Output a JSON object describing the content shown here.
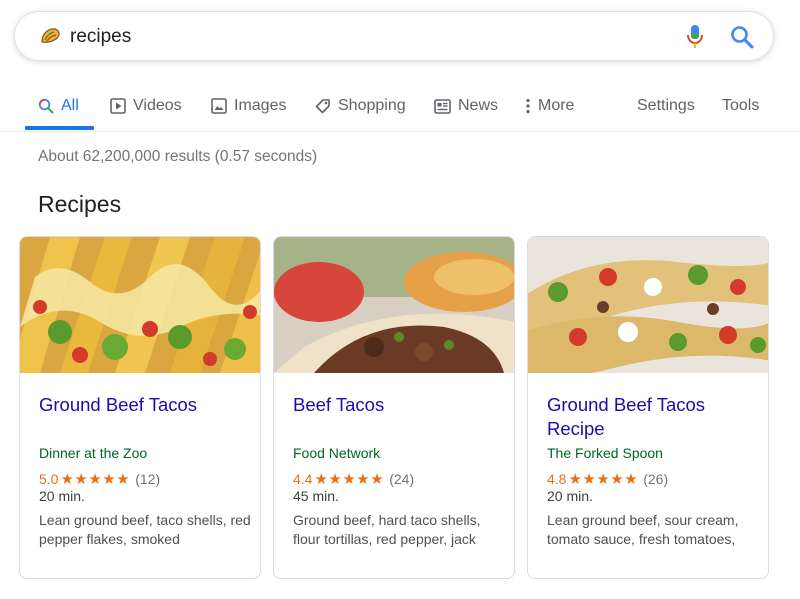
{
  "search": {
    "query": "recipes",
    "icons": {
      "left": "taco-doodle-icon",
      "mic": "mic-icon",
      "search": "search-icon"
    }
  },
  "tabs": [
    {
      "label": "All",
      "icon": "search-icon",
      "active": true
    },
    {
      "label": "Videos",
      "icon": "play-icon"
    },
    {
      "label": "Images",
      "icon": "image-icon"
    },
    {
      "label": "Shopping",
      "icon": "tag-icon"
    },
    {
      "label": "News",
      "icon": "newspaper-icon"
    },
    {
      "label": "More",
      "icon": "more-vertical-icon"
    }
  ],
  "tools": {
    "settings": "Settings",
    "tools": "Tools"
  },
  "results_stats": "About 62,200,000 results (0.57 seconds)",
  "section_title": "Recipes",
  "cards": [
    {
      "title": "Ground Beef Tacos",
      "source": "Dinner at the Zoo",
      "rating": "5.0",
      "stars": "★★★★★",
      "reviews": "(12)",
      "time": "20 min.",
      "ingredients": "Lean ground beef, taco shells, red pepper flakes, smoked"
    },
    {
      "title": "Beef Tacos",
      "source": "Food Network",
      "rating": "4.4",
      "stars": "★★★★★",
      "reviews": "(24)",
      "time": "45 min.",
      "ingredients": "Ground beef, hard taco shells, flour tortillas, red pepper, jack"
    },
    {
      "title": "Ground Beef Tacos Recipe",
      "source": "The Forked Spoon",
      "rating": "4.8",
      "stars": "★★★★★",
      "reviews": "(26)",
      "time": "20 min.",
      "ingredients": "Lean ground beef, sour cream, tomato sauce, fresh tomatoes,"
    }
  ],
  "colors": {
    "accent": "#1a73e8",
    "link": "#1a0dab",
    "source": "#006621",
    "star": "#e7711b"
  }
}
